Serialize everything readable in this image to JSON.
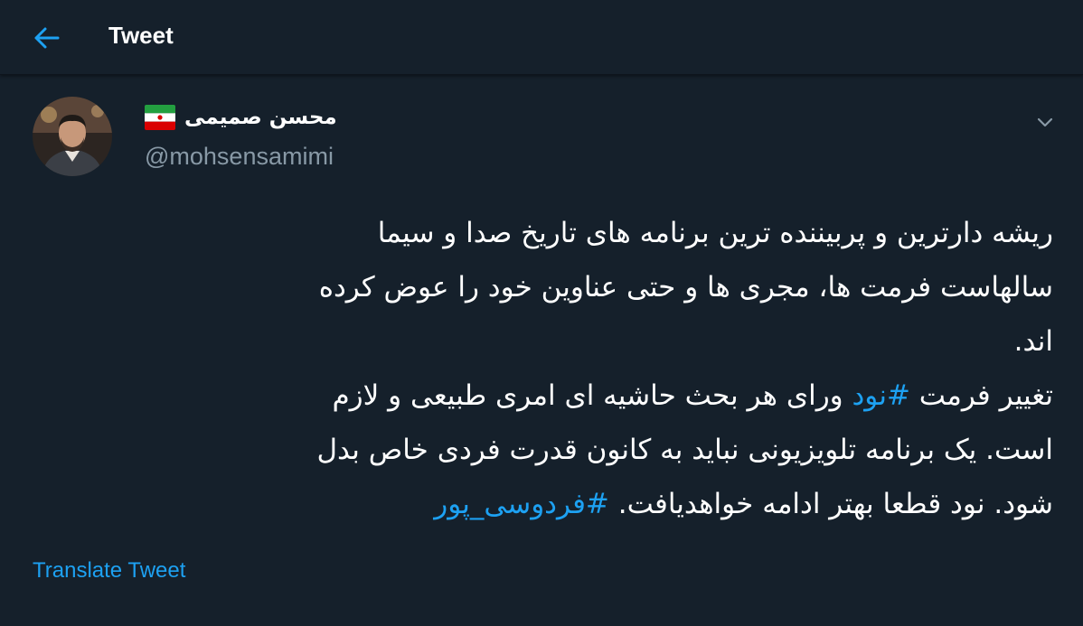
{
  "header": {
    "title": "Tweet",
    "back_icon": "arrow-left-icon"
  },
  "tweet": {
    "author": {
      "display_name": "محسن صمیمی",
      "flag": "iran-flag-icon",
      "handle": "@mohsensamimi",
      "avatar": "avatar"
    },
    "menu_icon": "chevron-down-icon",
    "body": {
      "line1": "ریشه دارترین و پربیننده ترین برنامه های تاریخ صدا و سیما",
      "line2": "سالهاست فرمت ها، مجری ها و حتی عناوین خود را عوض کرده",
      "line3": "اند.",
      "line4_before": "تغییر فرمت ",
      "line4_hashtag": "#نود",
      "line4_after": " ورای هر بحث حاشیه ای امری طبیعی و لازم",
      "line5": "است. یک برنامه تلویزیونی نباید به کانون قدرت فردی خاص بدل",
      "line6_before": "شود. نود قطعا بهتر ادامه خواهدیافت. ",
      "line6_hashtag": "#فردوسی_پور"
    },
    "translate_label": "Translate Tweet"
  },
  "colors": {
    "background": "#15202b",
    "accent": "#1da1f2",
    "secondary_text": "#8899a6"
  }
}
